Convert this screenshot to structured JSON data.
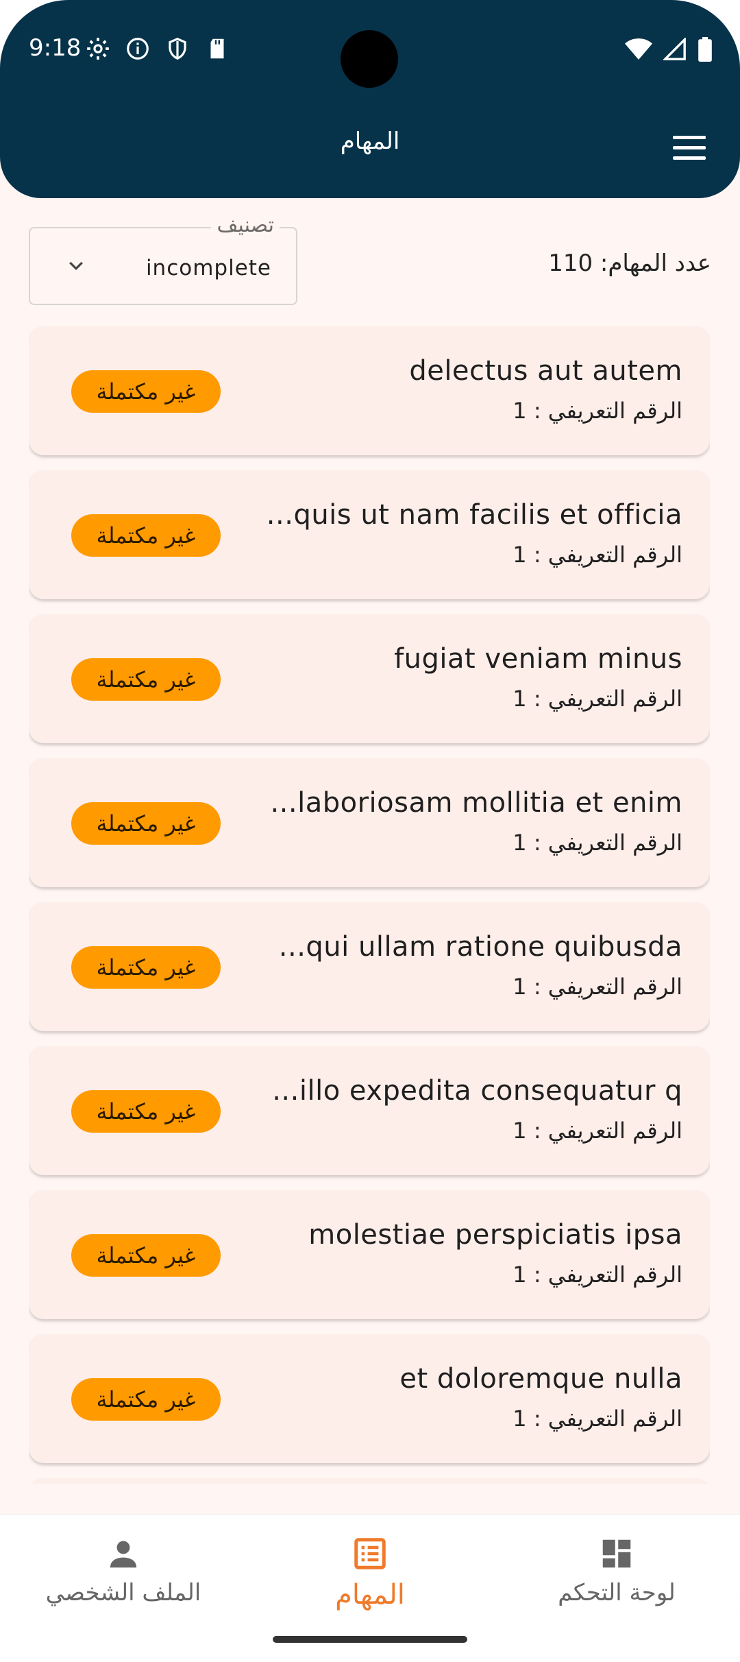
{
  "status_bar": {
    "time": "9:18",
    "icons": [
      "settings-icon",
      "info-icon",
      "shield-icon",
      "sd-card-icon",
      "wifi-icon",
      "signal-icon",
      "battery-icon"
    ]
  },
  "appbar": {
    "title": "المهام",
    "menu_icon": "hamburger-menu-icon"
  },
  "filter": {
    "count_text": "عدد المهام: 110",
    "dropdown_label": "تصنيف",
    "dropdown_value": "incomplete"
  },
  "tasks": [
    {
      "title": "delectus aut autem",
      "id_text": "الرقم التعريفي : 1",
      "status": "غير مكتملة"
    },
    {
      "title": "...quis ut nam facilis et officia",
      "id_text": "الرقم التعريفي : 1",
      "status": "غير مكتملة"
    },
    {
      "title": "fugiat veniam minus",
      "id_text": "الرقم التعريفي : 1",
      "status": "غير مكتملة"
    },
    {
      "title": "...laboriosam mollitia et enim",
      "id_text": "الرقم التعريفي : 1",
      "status": "غير مكتملة"
    },
    {
      "title": "...qui ullam ratione quibusda",
      "id_text": "الرقم التعريفي : 1",
      "status": "غير مكتملة"
    },
    {
      "title": "...illo expedita consequatur q",
      "id_text": "الرقم التعريفي : 1",
      "status": "غير مكتملة"
    },
    {
      "title": "molestiae perspiciatis ipsa",
      "id_text": "الرقم التعريفي : 1",
      "status": "غير مكتملة"
    },
    {
      "title": "et doloremque nulla",
      "id_text": "الرقم التعريفي : 1",
      "status": "غير مكتملة"
    }
  ],
  "colors": {
    "appbar": "#063349",
    "background": "#fff5f2",
    "card": "#fdeeea",
    "badge": "#ff9a00",
    "active_nav": "#ef7a2b"
  },
  "bottom_nav": {
    "items": [
      {
        "label": "الملف الشخصي",
        "icon": "person-icon",
        "active": false
      },
      {
        "label": "المهام",
        "icon": "task-list-icon",
        "active": true
      },
      {
        "label": "لوحة التحكم",
        "icon": "dashboard-icon",
        "active": false
      }
    ]
  }
}
